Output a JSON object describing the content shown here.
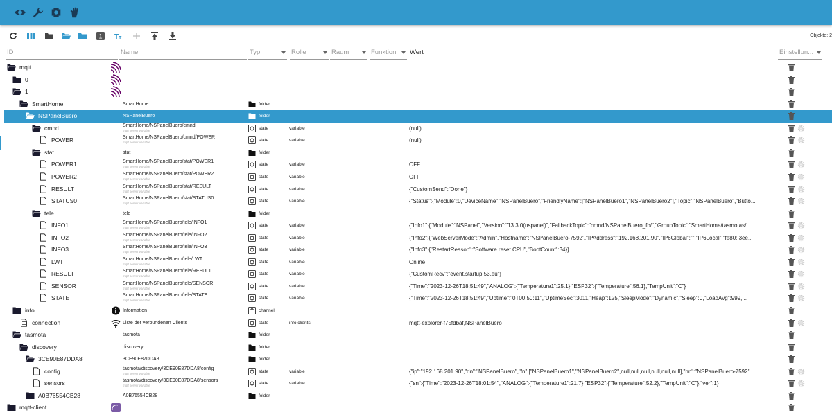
{
  "topbar": {
    "icons": [
      "eye-icon",
      "wrench-icon",
      "theme-icon",
      "hand-icon"
    ]
  },
  "toolbar": {
    "icons": [
      "refresh-icon",
      "columns-icon",
      "folder-closed-icon",
      "folder-open-icon",
      "folder-icon",
      "number-one-icon",
      "text-icon",
      "plus-icon",
      "upload-icon",
      "download-icon"
    ],
    "object_count": "Objekte: 2"
  },
  "filters": {
    "id_placeholder": "ID",
    "name_placeholder": "Name",
    "type": "Typ",
    "role": "Rolle",
    "room": "Raum",
    "function": "Funktion",
    "value": "Wert",
    "settings": "Einstellun..."
  },
  "colors": {
    "accent": "#3399cc",
    "folder": "#1a1a2e"
  },
  "rows": [
    {
      "name": "mqtt",
      "depth": 0,
      "icon": "folder-open",
      "logo": "mqtt",
      "obj_name": "",
      "obj_sub": "",
      "type": "",
      "type_icon": "",
      "role": "",
      "value": "",
      "gear": false
    },
    {
      "name": "0",
      "depth": 1,
      "icon": "folder",
      "logo": "mqtt",
      "obj_name": "",
      "obj_sub": "",
      "type": "",
      "type_icon": "",
      "role": "",
      "value": "",
      "gear": false
    },
    {
      "name": "1",
      "depth": 1,
      "icon": "folder-open",
      "logo": "mqtt",
      "obj_name": "",
      "obj_sub": "",
      "type": "",
      "type_icon": "",
      "role": "",
      "value": "",
      "gear": false
    },
    {
      "name": "SmartHome",
      "depth": 2,
      "icon": "folder-open",
      "logo": "",
      "obj_name": "SmartHome",
      "obj_sub": "",
      "type": "folder",
      "type_icon": "folder",
      "role": "",
      "value": "",
      "gear": false
    },
    {
      "name": "NSPanelBuero",
      "depth": 3,
      "icon": "folder-open",
      "logo": "",
      "obj_name": "NSPanelBuero",
      "obj_sub": "",
      "type": "folder",
      "type_icon": "folder",
      "role": "",
      "value": "",
      "gear": false,
      "selected": true
    },
    {
      "name": "cmnd",
      "depth": 4,
      "icon": "folder-open",
      "logo": "",
      "obj_name": "SmartHome/NSPanelBuero/cmnd",
      "obj_sub": "mqtt server variable",
      "type": "state",
      "type_icon": "state",
      "role": "variable",
      "value": "(null)",
      "gear": true
    },
    {
      "name": "POWER",
      "depth": 5,
      "icon": "file",
      "logo": "",
      "obj_name": "SmartHome/NSPanelBuero/cmnd/POWER",
      "obj_sub": "mqtt server variable",
      "type": "state",
      "type_icon": "state",
      "role": "variable",
      "value": "(null)",
      "gear": true
    },
    {
      "name": "stat",
      "depth": 4,
      "icon": "folder-open",
      "logo": "",
      "obj_name": "stat",
      "obj_sub": "",
      "type": "folder",
      "type_icon": "folder",
      "role": "",
      "value": "",
      "gear": false
    },
    {
      "name": "POWER1",
      "depth": 5,
      "icon": "file",
      "logo": "",
      "obj_name": "SmartHome/NSPanelBuero/stat/POWER1",
      "obj_sub": "mqtt server variable",
      "type": "state",
      "type_icon": "state",
      "role": "variable",
      "value": "OFF",
      "gear": true
    },
    {
      "name": "POWER2",
      "depth": 5,
      "icon": "file",
      "logo": "",
      "obj_name": "SmartHome/NSPanelBuero/stat/POWER2",
      "obj_sub": "mqtt server variable",
      "type": "state",
      "type_icon": "state",
      "role": "variable",
      "value": "OFF",
      "gear": true
    },
    {
      "name": "RESULT",
      "depth": 5,
      "icon": "file",
      "logo": "",
      "obj_name": "SmartHome/NSPanelBuero/stat/RESULT",
      "obj_sub": "mqtt server variable",
      "type": "state",
      "type_icon": "state",
      "role": "variable",
      "value": "{\"CustomSend\":\"Done\"}",
      "gear": true
    },
    {
      "name": "STATUS0",
      "depth": 5,
      "icon": "file",
      "logo": "",
      "obj_name": "SmartHome/NSPanelBuero/stat/STATUS0",
      "obj_sub": "mqtt server variable",
      "type": "state",
      "type_icon": "state",
      "role": "variable",
      "value": "{\"Status\":{\"Module\":0,\"DeviceName\":\"NSPanelBuero\",\"FriendlyName\":[\"NSPanelBuero1\",\"NSPanelBuero2\"],\"Topic\":\"NSPanelBuero\",\"Butto...",
      "gear": true
    },
    {
      "name": "tele",
      "depth": 4,
      "icon": "folder-open",
      "logo": "",
      "obj_name": "tele",
      "obj_sub": "",
      "type": "folder",
      "type_icon": "folder",
      "role": "",
      "value": "",
      "gear": false
    },
    {
      "name": "INFO1",
      "depth": 5,
      "icon": "file",
      "logo": "",
      "obj_name": "SmartHome/NSPanelBuero/tele/INFO1",
      "obj_sub": "mqtt server variable",
      "type": "state",
      "type_icon": "state",
      "role": "variable",
      "value": "{\"Info1\":{\"Module\":\"NSPanel\",\"Version\":\"13.3.0(nspanel)\",\"FallbackTopic\":\"cmnd/NSPanelBuero_fb/\",\"GroupTopic\":\"SmartHome/tasmotas/...",
      "gear": true
    },
    {
      "name": "INFO2",
      "depth": 5,
      "icon": "file",
      "logo": "",
      "obj_name": "SmartHome/NSPanelBuero/tele/INFO2",
      "obj_sub": "mqtt server variable",
      "type": "state",
      "type_icon": "state",
      "role": "variable",
      "value": "{\"Info2\":{\"WebServerMode\":\"Admin\",\"Hostname\":\"NSPanelBuero-7592\",\"IPAddress\":\"192.168.201.90\",\"IP6Global\":\"\",\"IP6Local\":\"fe80::3ee...",
      "gear": true
    },
    {
      "name": "INFO3",
      "depth": 5,
      "icon": "file",
      "logo": "",
      "obj_name": "SmartHome/NSPanelBuero/tele/INFO3",
      "obj_sub": "mqtt server variable",
      "type": "state",
      "type_icon": "state",
      "role": "variable",
      "value": "{\"Info3\":{\"RestartReason\":\"Software reset CPU\",\"BootCount\":34}}",
      "gear": true
    },
    {
      "name": "LWT",
      "depth": 5,
      "icon": "file",
      "logo": "",
      "obj_name": "SmartHome/NSPanelBuero/tele/LWT",
      "obj_sub": "mqtt server variable",
      "type": "state",
      "type_icon": "state",
      "role": "variable",
      "value": "Online",
      "gear": true
    },
    {
      "name": "RESULT",
      "depth": 5,
      "icon": "file",
      "logo": "",
      "obj_name": "SmartHome/NSPanelBuero/tele/RESULT",
      "obj_sub": "mqtt server variable",
      "type": "state",
      "type_icon": "state",
      "role": "variable",
      "value": "{\"CustomRecv\":\"event,startup,53,eu\"}",
      "gear": true
    },
    {
      "name": "SENSOR",
      "depth": 5,
      "icon": "file",
      "logo": "",
      "obj_name": "SmartHome/NSPanelBuero/tele/SENSOR",
      "obj_sub": "mqtt server variable",
      "type": "state",
      "type_icon": "state",
      "role": "variable",
      "value": "{\"Time\":\"2023-12-26T18:51:49\",\"ANALOG\":{\"Temperature1\":25.1},\"ESP32\":{\"Temperature\":56.1},\"TempUnit\":\"C\"}",
      "gear": true
    },
    {
      "name": "STATE",
      "depth": 5,
      "icon": "file",
      "logo": "",
      "obj_name": "SmartHome/NSPanelBuero/tele/STATE",
      "obj_sub": "mqtt server variable",
      "type": "state",
      "type_icon": "state",
      "role": "variable",
      "value": "{\"Time\":\"2023-12-26T18:51:49\",\"Uptime\":\"0T00:50:11\",\"UptimeSec\":3011,\"Heap\":125,\"SleepMode\":\"Dynamic\",\"Sleep\":0,\"LoadAvg\":999,...",
      "gear": true
    },
    {
      "name": "info",
      "depth": 1,
      "icon": "folder",
      "logo": "info",
      "obj_name": "Information",
      "obj_sub": "",
      "type": "channel",
      "type_icon": "channel",
      "role": "",
      "value": "",
      "gear": false
    },
    {
      "name": "connection",
      "depth": 2,
      "icon": "file-text",
      "logo": "wifi",
      "obj_name": "Liste der verbundenen Clients",
      "obj_sub": "",
      "type": "state",
      "type_icon": "state",
      "role": "info.clients",
      "value": "mqtt-explorer-f75fdbaf,NSPanelBuero",
      "gear": true
    },
    {
      "name": "tasmota",
      "depth": 1,
      "icon": "folder-open",
      "logo": "",
      "obj_name": "tasmota",
      "obj_sub": "",
      "type": "folder",
      "type_icon": "folder",
      "role": "",
      "value": "",
      "gear": false
    },
    {
      "name": "discovery",
      "depth": 2,
      "icon": "folder-open",
      "logo": "",
      "obj_name": "discovery",
      "obj_sub": "",
      "type": "folder",
      "type_icon": "folder",
      "role": "",
      "value": "",
      "gear": false
    },
    {
      "name": "3CE90E87DDA8",
      "depth": 3,
      "icon": "folder-open",
      "logo": "",
      "obj_name": "3CE90E87DDA8",
      "obj_sub": "",
      "type": "folder",
      "type_icon": "folder",
      "role": "",
      "value": "",
      "gear": false
    },
    {
      "name": "config",
      "depth": 4,
      "icon": "file",
      "logo": "",
      "obj_name": "tasmota/discovery/3CE90E87DDA8/config",
      "obj_sub": "mqtt server variable",
      "type": "state",
      "type_icon": "state",
      "role": "variable",
      "value": "{\"ip\":\"192.168.201.90\",\"dn\":\"NSPanelBuero\",\"fn\":[\"NSPanelBuero1\",\"NSPanelBuero2\",null,null,null,null,null,null],\"hn\":\"NSPanelBuero-7592\"...",
      "gear": true
    },
    {
      "name": "sensors",
      "depth": 4,
      "icon": "file",
      "logo": "",
      "obj_name": "tasmota/discovery/3CE90E87DDA8/sensors",
      "obj_sub": "mqtt server variable",
      "type": "state",
      "type_icon": "state",
      "role": "variable",
      "value": "{\"sn\":{\"Time\":\"2023-12-26T18:01:54\",\"ANALOG\":{\"Temperature1\":21.7},\"ESP32\":{\"Temperature\":52.2},\"TempUnit\":\"C\"},\"ver\":1}",
      "gear": true
    },
    {
      "name": "A0B76554CB28",
      "depth": 3,
      "icon": "folder",
      "logo": "",
      "obj_name": "A0B76554CB28",
      "obj_sub": "",
      "type": "folder",
      "type_icon": "folder",
      "role": "",
      "value": "",
      "gear": false
    },
    {
      "name": "mqtt-client",
      "depth": 0,
      "icon": "folder",
      "logo": "client",
      "obj_name": "",
      "obj_sub": "",
      "type": "",
      "type_icon": "",
      "role": "",
      "value": "",
      "gear": false
    }
  ]
}
